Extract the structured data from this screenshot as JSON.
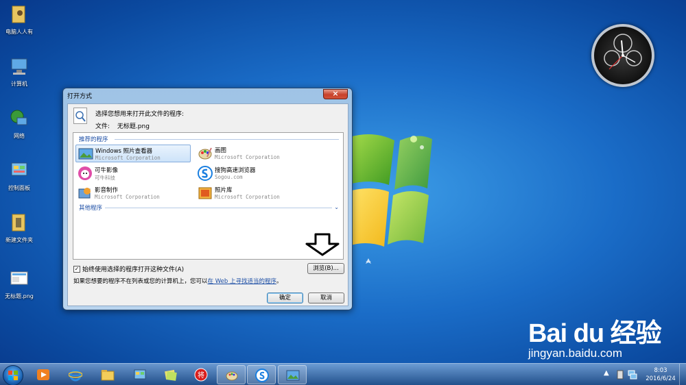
{
  "desktop": {
    "icons": [
      {
        "label": "电脑人人有"
      },
      {
        "label": "计算机"
      },
      {
        "label": "网络"
      },
      {
        "label": "控制面板"
      },
      {
        "label": "新建文件夹"
      },
      {
        "label": "无标题.png"
      }
    ]
  },
  "dialog": {
    "title": "打开方式",
    "close_label": "×",
    "prompt": "选择您想用来打开此文件的程序:",
    "file_label": "文件:",
    "file_name": "无标题.png",
    "recommended_label": "推荐的程序",
    "other_label": "其他程序",
    "other_chevron": "⌄",
    "programs": [
      {
        "name": "Windows 照片查看器",
        "company": "Microsoft Corporation"
      },
      {
        "name": "画图",
        "company": "Microsoft Corporation"
      },
      {
        "name": "可牛影像",
        "company": "可牛科技"
      },
      {
        "name": "搜狗高速浏览器",
        "company": "Sogou.com"
      },
      {
        "name": "影音制作",
        "company": "Microsoft Corporation"
      },
      {
        "name": "照片库",
        "company": "Microsoft Corporation"
      }
    ],
    "always_use_label": "始终使用选择的程序打开这种文件(A)",
    "always_use_checked": true,
    "check_mark": "✓",
    "browse_label": "浏览(B)...",
    "info_text": "如果您想要的程序不在列表或您的计算机上，您可以",
    "info_link": "在 Web 上寻找适当的程序",
    "info_end": "。",
    "ok_label": "确定",
    "cancel_label": "取消"
  },
  "watermark": {
    "logo": "Bai du 经验",
    "url": "jingyan.baidu.com"
  },
  "taskbar": {
    "tray_arrow": "▲",
    "time": "8:03",
    "date": "2016/6/24"
  }
}
